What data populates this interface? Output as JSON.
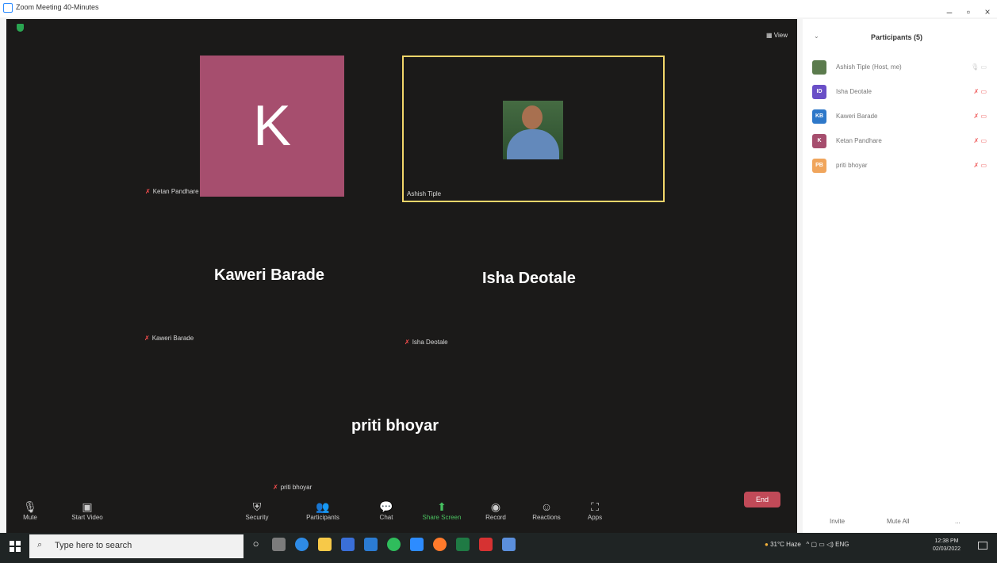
{
  "window": {
    "title": "Zoom Meeting 40-Minutes",
    "controls": [
      "–",
      "▫",
      "×"
    ]
  },
  "meeting": {
    "view_label": "View",
    "tiles": {
      "ketan": {
        "initial": "K",
        "name": "Ketan Pandhare",
        "color": "#a64e6e"
      },
      "ashish": {
        "name": "Ashish Tiple"
      },
      "kaweri": {
        "big_name": "Kaweri Barade",
        "name": "Kaweri Barade"
      },
      "isha": {
        "big_name": "Isha Deotale",
        "name": "Isha Deotale"
      },
      "priti": {
        "big_name": "priti bhoyar",
        "name": "priti bhoyar"
      }
    }
  },
  "toolbar": {
    "mute": "Mute",
    "start_video": "Start Video",
    "security": "Security",
    "participants": "Participants",
    "participant_count": "5",
    "chat": "Chat",
    "share_screen": "Share Screen",
    "record": "Record",
    "reactions": "Reactions",
    "apps": "Apps",
    "end": "End"
  },
  "participants_panel": {
    "title": "Participants (5)",
    "items": [
      {
        "initials": "",
        "name": "Ashish Tiple (Host, me)",
        "color": "#5b7b4d"
      },
      {
        "initials": "ID",
        "name": "Isha Deotale",
        "color": "#6a4fc7"
      },
      {
        "initials": "KB",
        "name": "Kaweri Barade",
        "color": "#2e78c9"
      },
      {
        "initials": "K",
        "name": "Ketan Pandhare",
        "color": "#a64e6e"
      },
      {
        "initials": "PB",
        "name": "priti bhoyar",
        "color": "#f0a55c"
      }
    ],
    "invite": "Invite",
    "mute_all": "Mute All",
    "more": "..."
  },
  "taskbar": {
    "search_placeholder": "Type here to search",
    "weather": "31°C Haze",
    "lang": "ENG",
    "time": "12:38 PM",
    "date": "02/03/2022"
  }
}
